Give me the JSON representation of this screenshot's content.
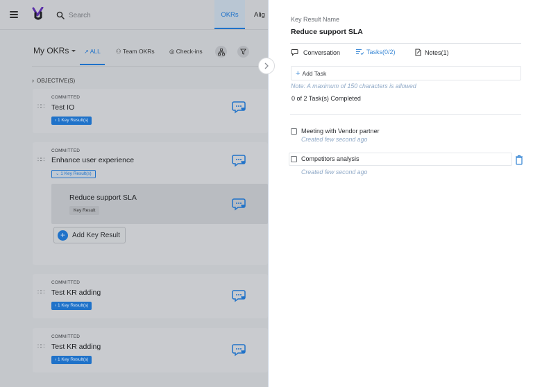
{
  "header": {
    "search_placeholder": "Search",
    "nav": [
      {
        "label": "OKRs"
      },
      {
        "label": "Alig"
      }
    ]
  },
  "okr_toolbar": {
    "title": "My OKRs",
    "tabs": [
      {
        "label": "ALL"
      },
      {
        "label": "Team OKRs"
      },
      {
        "label": "Check-ins"
      }
    ],
    "objectives_label": "OBJECTIVE(S)"
  },
  "objectives": [
    {
      "status": "COMMITTED",
      "title": "Test IO",
      "kr_label": "1 Key Result(s)"
    },
    {
      "status": "COMMITTED",
      "title": "Enhance user experience",
      "kr_label": "1 Key Result(s)",
      "key_result": {
        "title": "Reduce support SLA",
        "badge": "Key Result"
      },
      "add_kr_label": "Add Key Result"
    },
    {
      "status": "COMMITTED",
      "title": "Test KR adding",
      "kr_label": "1 Key Result(s)"
    },
    {
      "status": "COMMITTED",
      "title": "Test KR adding",
      "kr_label": "1 Key Result(s)"
    }
  ],
  "panel": {
    "label": "Key Result Name",
    "title": "Reduce support SLA",
    "tabs": [
      {
        "label": "Conversation"
      },
      {
        "label": "Tasks(0/2)"
      },
      {
        "label": "Notes(1)"
      }
    ],
    "add_task_label": "Add Task",
    "note": "Note: A maximum of 150 characters is allowed",
    "completed_text": "0 of 2 Task(s) Completed",
    "tasks": [
      {
        "title": "Meeting with Vendor partner",
        "meta": "Created few second ago",
        "checked": false
      },
      {
        "title": "Competitors analysis",
        "meta": "Created few second ago",
        "checked": false
      }
    ]
  },
  "colors": {
    "accent": "#1f72c9",
    "link": "#3d8ad6",
    "overlay": "#c4c7cb"
  }
}
